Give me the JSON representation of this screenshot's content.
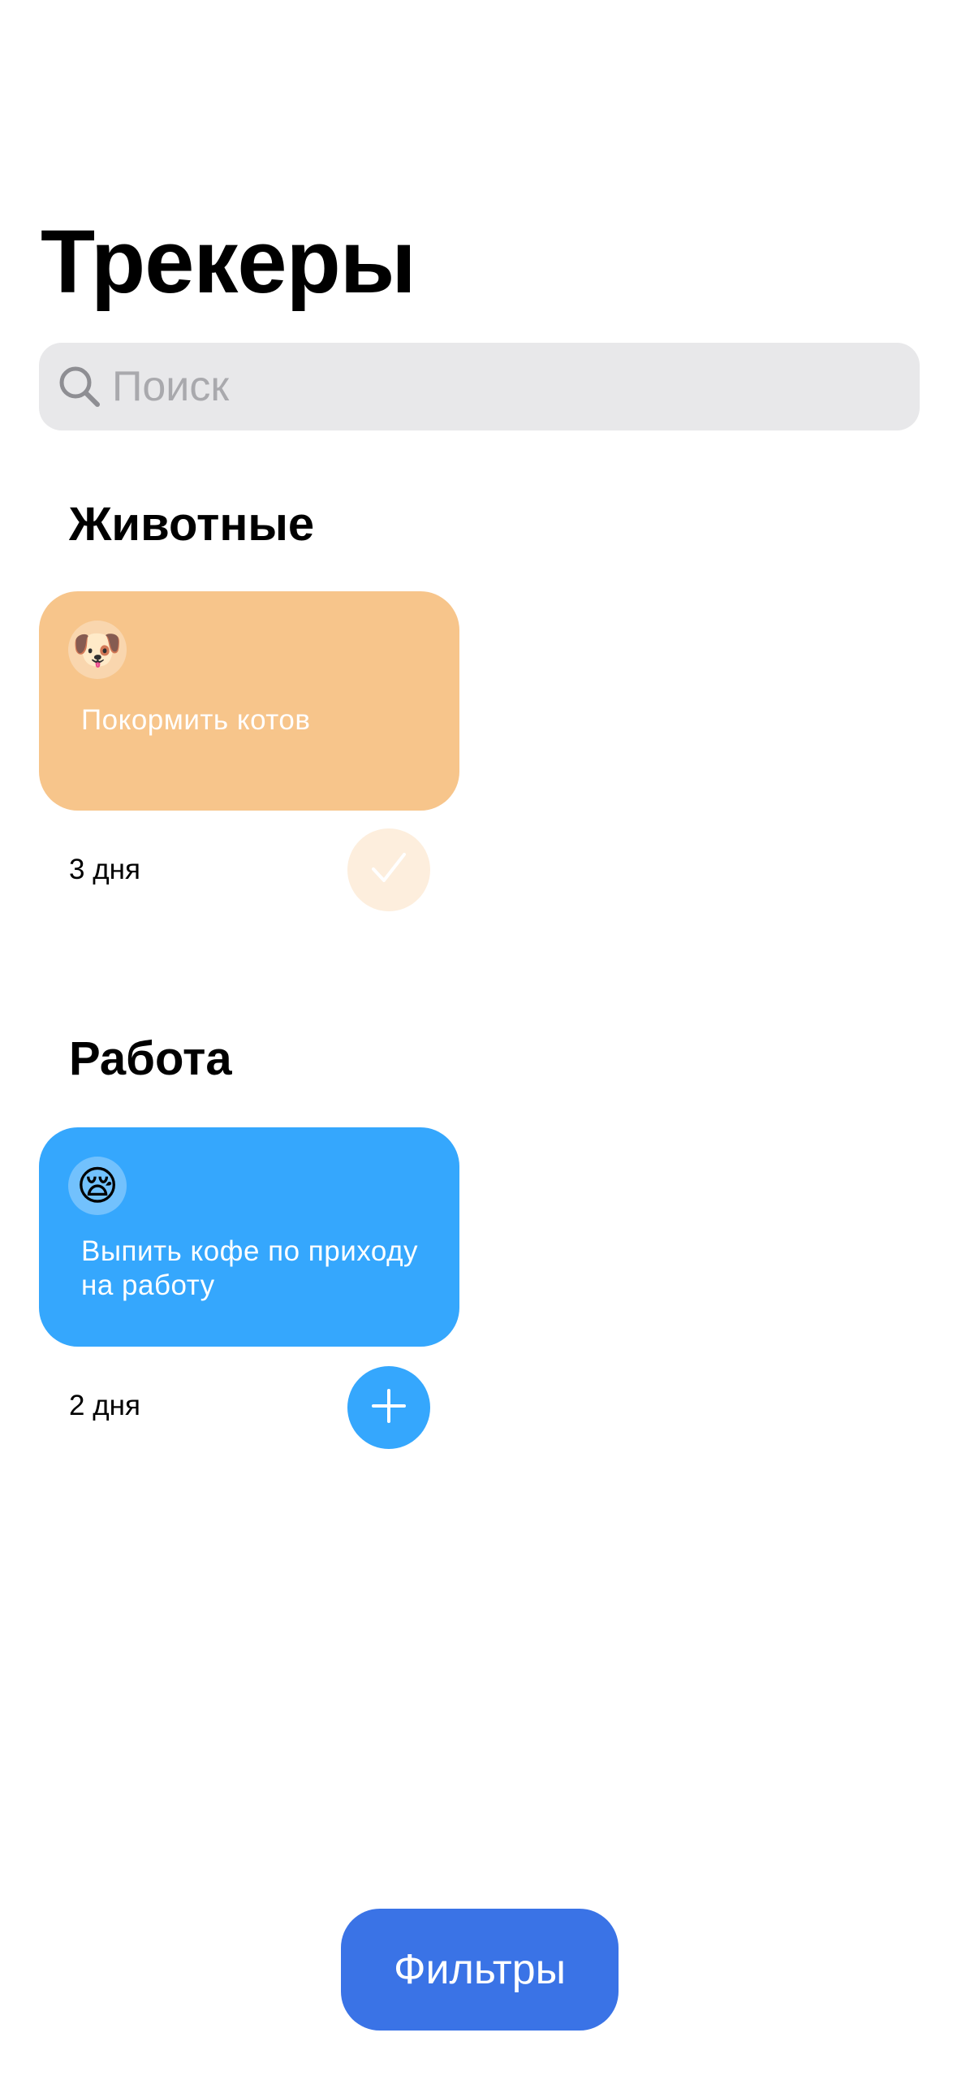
{
  "header": {
    "title": "Трекеры"
  },
  "search": {
    "placeholder": "Поиск",
    "icon": "magnifying-glass-icon"
  },
  "sections": [
    {
      "title": "Животные",
      "trackers": [
        {
          "emoji": "🐶",
          "title": "Покормить котов",
          "days": "3 дня",
          "color": "#f7c58b",
          "completed": true,
          "action_icon": "checkmark-icon",
          "action_color": "#fdeedd"
        }
      ]
    },
    {
      "title": "Работа",
      "trackers": [
        {
          "emoji": "😪",
          "title": "Выпить кофе по приходу на работу",
          "days": "2 дня",
          "color": "#35a7fd",
          "completed": false,
          "action_icon": "plus-icon",
          "action_color": "#35a7fd"
        }
      ]
    }
  ],
  "footer": {
    "filters_label": "Фильтры",
    "filters_color": "#3a73e6"
  }
}
